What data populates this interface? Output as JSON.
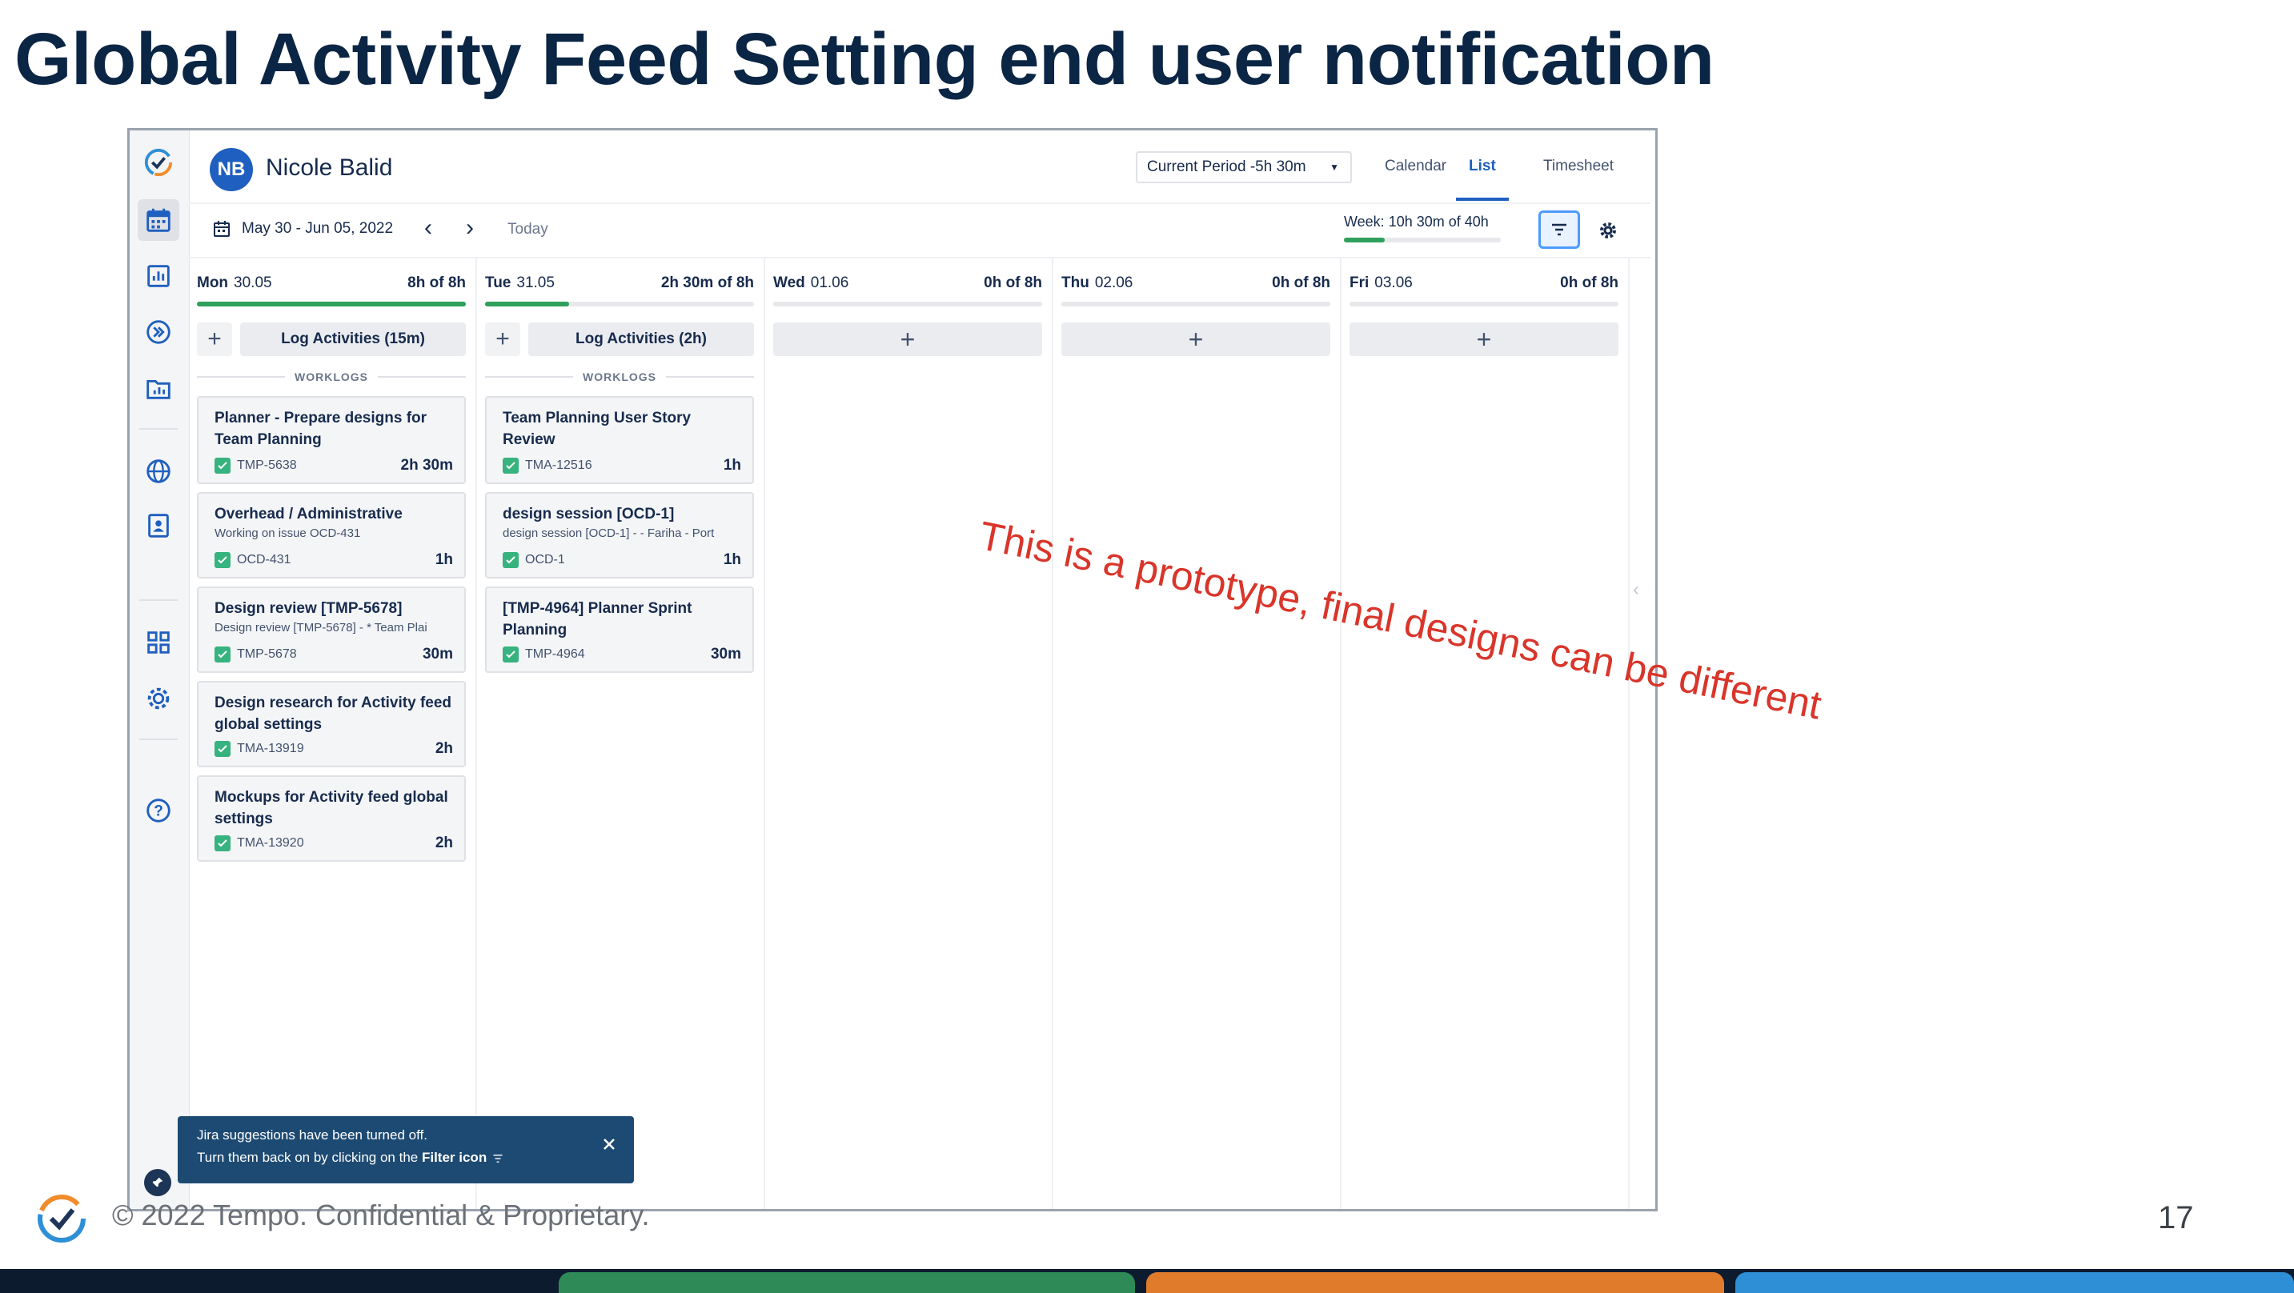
{
  "slide": {
    "title": "Global Activity Feed Setting end user notification",
    "watermark": "This is a prototype, final designs can be different",
    "footer_text": "© 2022 Tempo. Confidential & Proprietary.",
    "page_number": "17"
  },
  "header": {
    "avatar_initials": "NB",
    "user_name": "Nicole Balid",
    "period_select": "Current Period -5h 30m",
    "tabs": [
      {
        "label": "Calendar",
        "active": false
      },
      {
        "label": "List",
        "active": true
      },
      {
        "label": "Timesheet",
        "active": false
      }
    ]
  },
  "toolbar": {
    "date_range": "May 30 - Jun 05, 2022",
    "today": "Today",
    "week_label": "Week: 10h 30m of 40h",
    "week_progress": 0.2625
  },
  "days": [
    {
      "name": "Mon",
      "date": "30.05",
      "hours": "8h of 8h",
      "progress": 1.0,
      "log_label": "Log Activities (15m)",
      "worklogs_label": "WORKLOGS"
    },
    {
      "name": "Tue",
      "date": "31.05",
      "hours": "2h 30m of 8h",
      "progress": 0.3125,
      "log_label": "Log Activities (2h)",
      "worklogs_label": "WORKLOGS"
    },
    {
      "name": "Wed",
      "date": "01.06",
      "hours": "0h of 8h",
      "progress": 0
    },
    {
      "name": "Thu",
      "date": "02.06",
      "hours": "0h of 8h",
      "progress": 0
    },
    {
      "name": "Fri",
      "date": "03.06",
      "hours": "0h of 8h",
      "progress": 0
    }
  ],
  "worklogs": {
    "mon": [
      {
        "title": "Planner - Prepare designs for Team Planning",
        "sub": "",
        "key": "TMP-5638",
        "duration": "2h 30m"
      },
      {
        "title": "Overhead / Administrative",
        "sub": "Working on issue OCD-431",
        "key": "OCD-431",
        "duration": "1h"
      },
      {
        "title": "Design review [TMP-5678]",
        "sub": "Design review [TMP-5678] - * Team Plai",
        "key": "TMP-5678",
        "duration": "30m"
      },
      {
        "title": "Design research for Activity feed global settings",
        "sub": "",
        "key": "TMA-13919",
        "duration": "2h"
      },
      {
        "title": "Mockups for Activity feed global settings",
        "sub": "",
        "key": "TMA-13920",
        "duration": "2h"
      }
    ],
    "tue": [
      {
        "title": "Team Planning User Story Review",
        "sub": "",
        "key": "TMA-12516",
        "duration": "1h"
      },
      {
        "title": "design session [OCD-1]",
        "sub": "design session [OCD-1] - - Fariha - Port",
        "key": "OCD-1",
        "duration": "1h"
      },
      {
        "title": "[TMP-4964] Planner Sprint Planning",
        "sub": "",
        "key": "TMP-4964",
        "duration": "30m"
      }
    ]
  },
  "toast": {
    "line1": "Jira suggestions have been turned off.",
    "line2_prefix": "Turn them back on by clicking on the",
    "line2_bold": "Filter icon"
  },
  "icons": {
    "sidebar": [
      "tempo-logo-icon",
      "calendar-icon",
      "bar-chart-icon",
      "forward-circle-icon",
      "folder-chart-icon",
      "globe-icon",
      "contact-icon",
      "apps-grid-icon",
      "gear-icon",
      "help-icon",
      "pin-icon"
    ],
    "toolbar": [
      "calendar-small-icon",
      "chevron-left-icon",
      "chevron-right-icon",
      "filter-icon",
      "gear-icon"
    ]
  },
  "colors": {
    "accent": "#1f5fbf",
    "progress": "#2ea05c",
    "toast_bg": "#1d4a72",
    "watermark": "#d9352a",
    "title": "#0b2545",
    "stripes": [
      "#0d1b2e",
      "#2e8b57",
      "#e07b2c",
      "#2e8fd6"
    ]
  }
}
